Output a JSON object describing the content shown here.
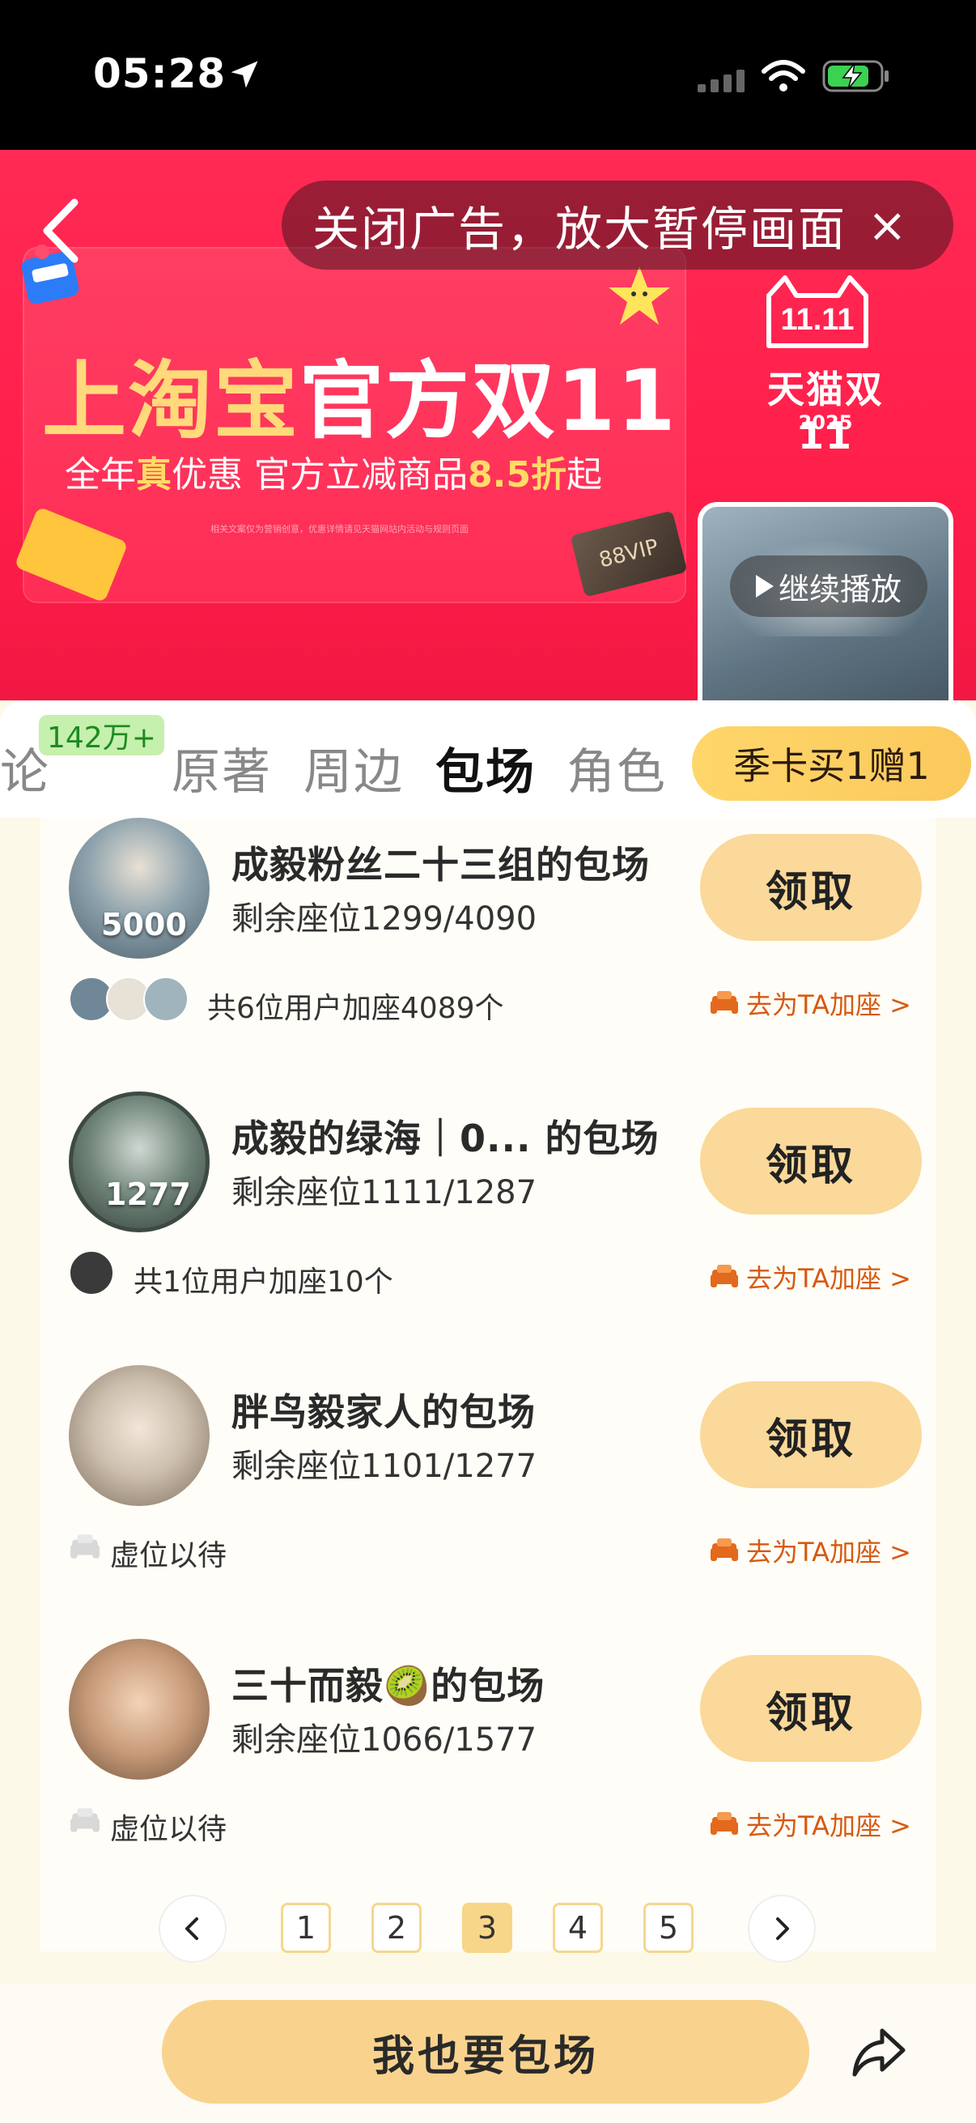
{
  "status_bar": {
    "time": "05:28"
  },
  "ad": {
    "close_label": "关闭广告，放大暂停画面",
    "close_x": "×",
    "headline_part1": "上淘宝",
    "headline_part2": "官方双11",
    "sub_part1": "全年",
    "sub_highlight1": "真",
    "sub_part2": "优惠 官方立减商品",
    "sub_highlight2": "8.5折",
    "sub_part3": "起",
    "fine_print": "相关文案仅为营销创意，优惠详情请见天猫网站内活动与规则页面",
    "vip_card": "88VIP",
    "brand_name": "天猫双11",
    "brand_year": "2025",
    "video_label": "继续播放"
  },
  "tabs": [
    {
      "label": "论"
    },
    {
      "label": "原著"
    },
    {
      "label": "周边"
    },
    {
      "label": "包场",
      "active": true
    },
    {
      "label": "角色"
    }
  ],
  "tab_badge": "142万+",
  "season_button": "季卡买1赠1",
  "items": [
    {
      "title": "成毅粉丝二十三组的包场",
      "seats": "剩余座位1299/4090",
      "avatar_count": "5000",
      "footer_text": "共6位用户加座4089个",
      "claim": "领取",
      "join": "去为TA加座 >"
    },
    {
      "title": "成毅的绿海｜0... 的包场",
      "seats": "剩余座位1111/1287",
      "avatar_count": "1277",
      "footer_text": "共1位用户加座10个",
      "claim": "领取",
      "join": "去为TA加座 >"
    },
    {
      "title": "胖鸟毅家人的包场",
      "seats": "剩余座位1101/1277",
      "footer_text": "虚位以待",
      "claim": "领取",
      "join": "去为TA加座 >"
    },
    {
      "title": "三十而毅🥝的包场",
      "seats": "剩余座位1066/1577",
      "footer_text": "虚位以待",
      "claim": "领取",
      "join": "去为TA加座 >"
    }
  ],
  "pagination": {
    "pages": [
      "1",
      "2",
      "3",
      "4",
      "5"
    ],
    "current": "3"
  },
  "cta": "我也要包场",
  "colors": {
    "ad_red": "#ff2a55",
    "accent_gold": "#f9d38e",
    "link_orange": "#d65a12",
    "badge_green": "#1d8a20"
  },
  "icons": {
    "back": "chevron-left-icon",
    "location": "location-arrow-icon",
    "wifi": "wifi-icon",
    "battery": "battery-charging-icon",
    "share": "share-icon",
    "seat": "seat-icon"
  }
}
